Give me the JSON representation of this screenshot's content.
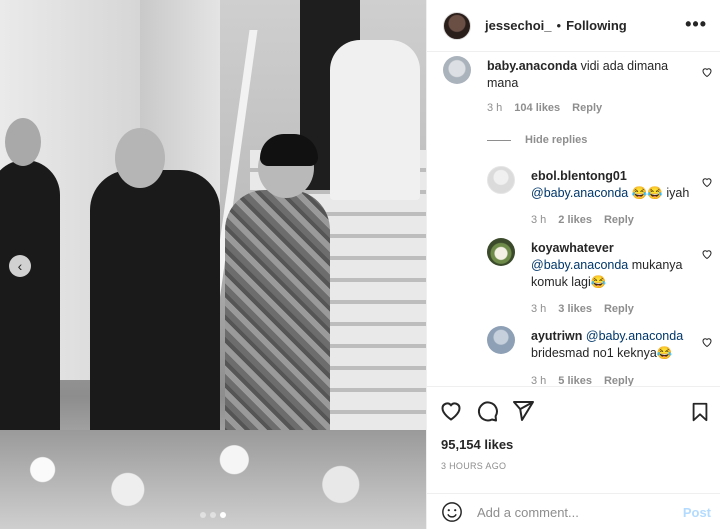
{
  "post": {
    "username": "jessechoi_",
    "separator": "•",
    "follow_status": "Following",
    "more_label": "•••",
    "likes": "95,154 likes",
    "time": "3 HOURS AGO"
  },
  "carousel": {
    "prev_icon": "chevron-left-icon",
    "slide_count": 3,
    "active_slide": 3
  },
  "comments": [
    {
      "user": "baby.anaconda",
      "text": "vidi ada dimana mana",
      "time": "3 h",
      "likes": "104 likes",
      "reply_label": "Reply"
    }
  ],
  "hide_replies_label": "Hide replies",
  "replies": [
    {
      "user": "ebol.blentong01",
      "mention": "@baby.anaconda",
      "text": "😂😂 iyah",
      "time": "3 h",
      "likes": "2 likes",
      "reply_label": "Reply"
    },
    {
      "user": "koyawhatever",
      "mention": "@baby.anaconda",
      "text": "mukanya komuk lagi😂",
      "time": "3 h",
      "likes": "3 likes",
      "reply_label": "Reply"
    },
    {
      "user": "ayutriwn",
      "mention": "@baby.anaconda",
      "text": "bridesmad no1 keknya😂",
      "time": "3 h",
      "likes": "5 likes",
      "reply_label": "Reply"
    }
  ],
  "composer": {
    "placeholder": "Add a comment...",
    "post_label": "Post"
  },
  "colors": {
    "mention": "#00376b",
    "meta": "#8e8e8e",
    "post_disabled": "#b3dbff"
  }
}
